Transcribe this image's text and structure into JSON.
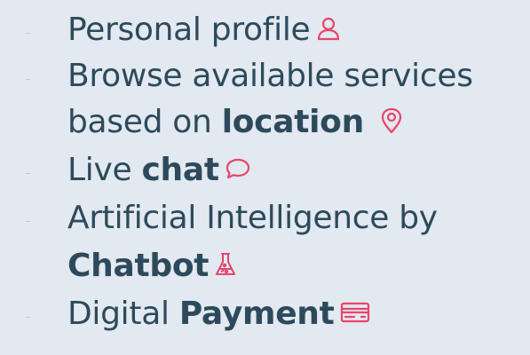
{
  "features": [
    {
      "prefix": "Personal profile",
      "bold": "",
      "icon": "user-icon"
    },
    {
      "prefix": "Browse available services",
      "bold": "",
      "icon": ""
    },
    {
      "prefix": "based on ",
      "bold": "location",
      "icon": "location-pin-icon"
    },
    {
      "prefix": "Live ",
      "bold": "chat",
      "icon": "chat-bubble-icon"
    },
    {
      "prefix": "Artificial Intelligence by",
      "bold": "",
      "icon": ""
    },
    {
      "prefix": "",
      "bold": "Chatbot",
      "icon": "lab-flask-icon"
    },
    {
      "prefix": "Digital ",
      "bold": "Payment",
      "icon": "credit-card-icon"
    }
  ],
  "bullet": "-",
  "colors": {
    "background": "#e2e9f0",
    "text": "#2d4a5c",
    "accent": "#e8456b",
    "dash": "#b7c3cd"
  }
}
